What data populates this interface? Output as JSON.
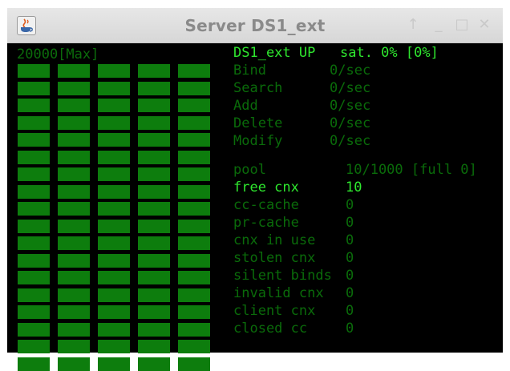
{
  "window": {
    "title": "Server DS1_ext",
    "controls": {
      "pin": "↑",
      "minimize": "_",
      "maximize": "□",
      "close": "✕"
    },
    "app_icon": "java-cup-icon"
  },
  "meter": {
    "max_label": "20000[Max]",
    "columns": 5,
    "rows": 18,
    "fill_fraction": 1.0,
    "color": "#0d7d0d"
  },
  "status": {
    "server_up": "DS1_ext UP",
    "saturation": "sat. 0% [0%]"
  },
  "rates": [
    {
      "label": "Bind",
      "value": "0/sec"
    },
    {
      "label": "Search",
      "value": "0/sec"
    },
    {
      "label": "Add",
      "value": "0/sec"
    },
    {
      "label": "Delete",
      "value": "0/sec"
    },
    {
      "label": "Modify",
      "value": "0/sec"
    }
  ],
  "pool": {
    "label": "pool",
    "value": "10/1000 [full 0]"
  },
  "free_cnx": {
    "label": "free cnx",
    "value": "10"
  },
  "stats": [
    {
      "label": "cc-cache",
      "value": "0"
    },
    {
      "label": "pr-cache",
      "value": "0"
    },
    {
      "label": "cnx in use",
      "value": "0"
    },
    {
      "label": "stolen cnx",
      "value": "0"
    },
    {
      "label": "silent binds",
      "value": "0"
    },
    {
      "label": "invalid cnx",
      "value": "0"
    },
    {
      "label": "client cnx",
      "value": "0"
    },
    {
      "label": "closed cc",
      "value": "0"
    }
  ],
  "colors": {
    "background": "#000000",
    "dim_green": "#0a6b0a",
    "bright_green": "#2ee62e"
  }
}
